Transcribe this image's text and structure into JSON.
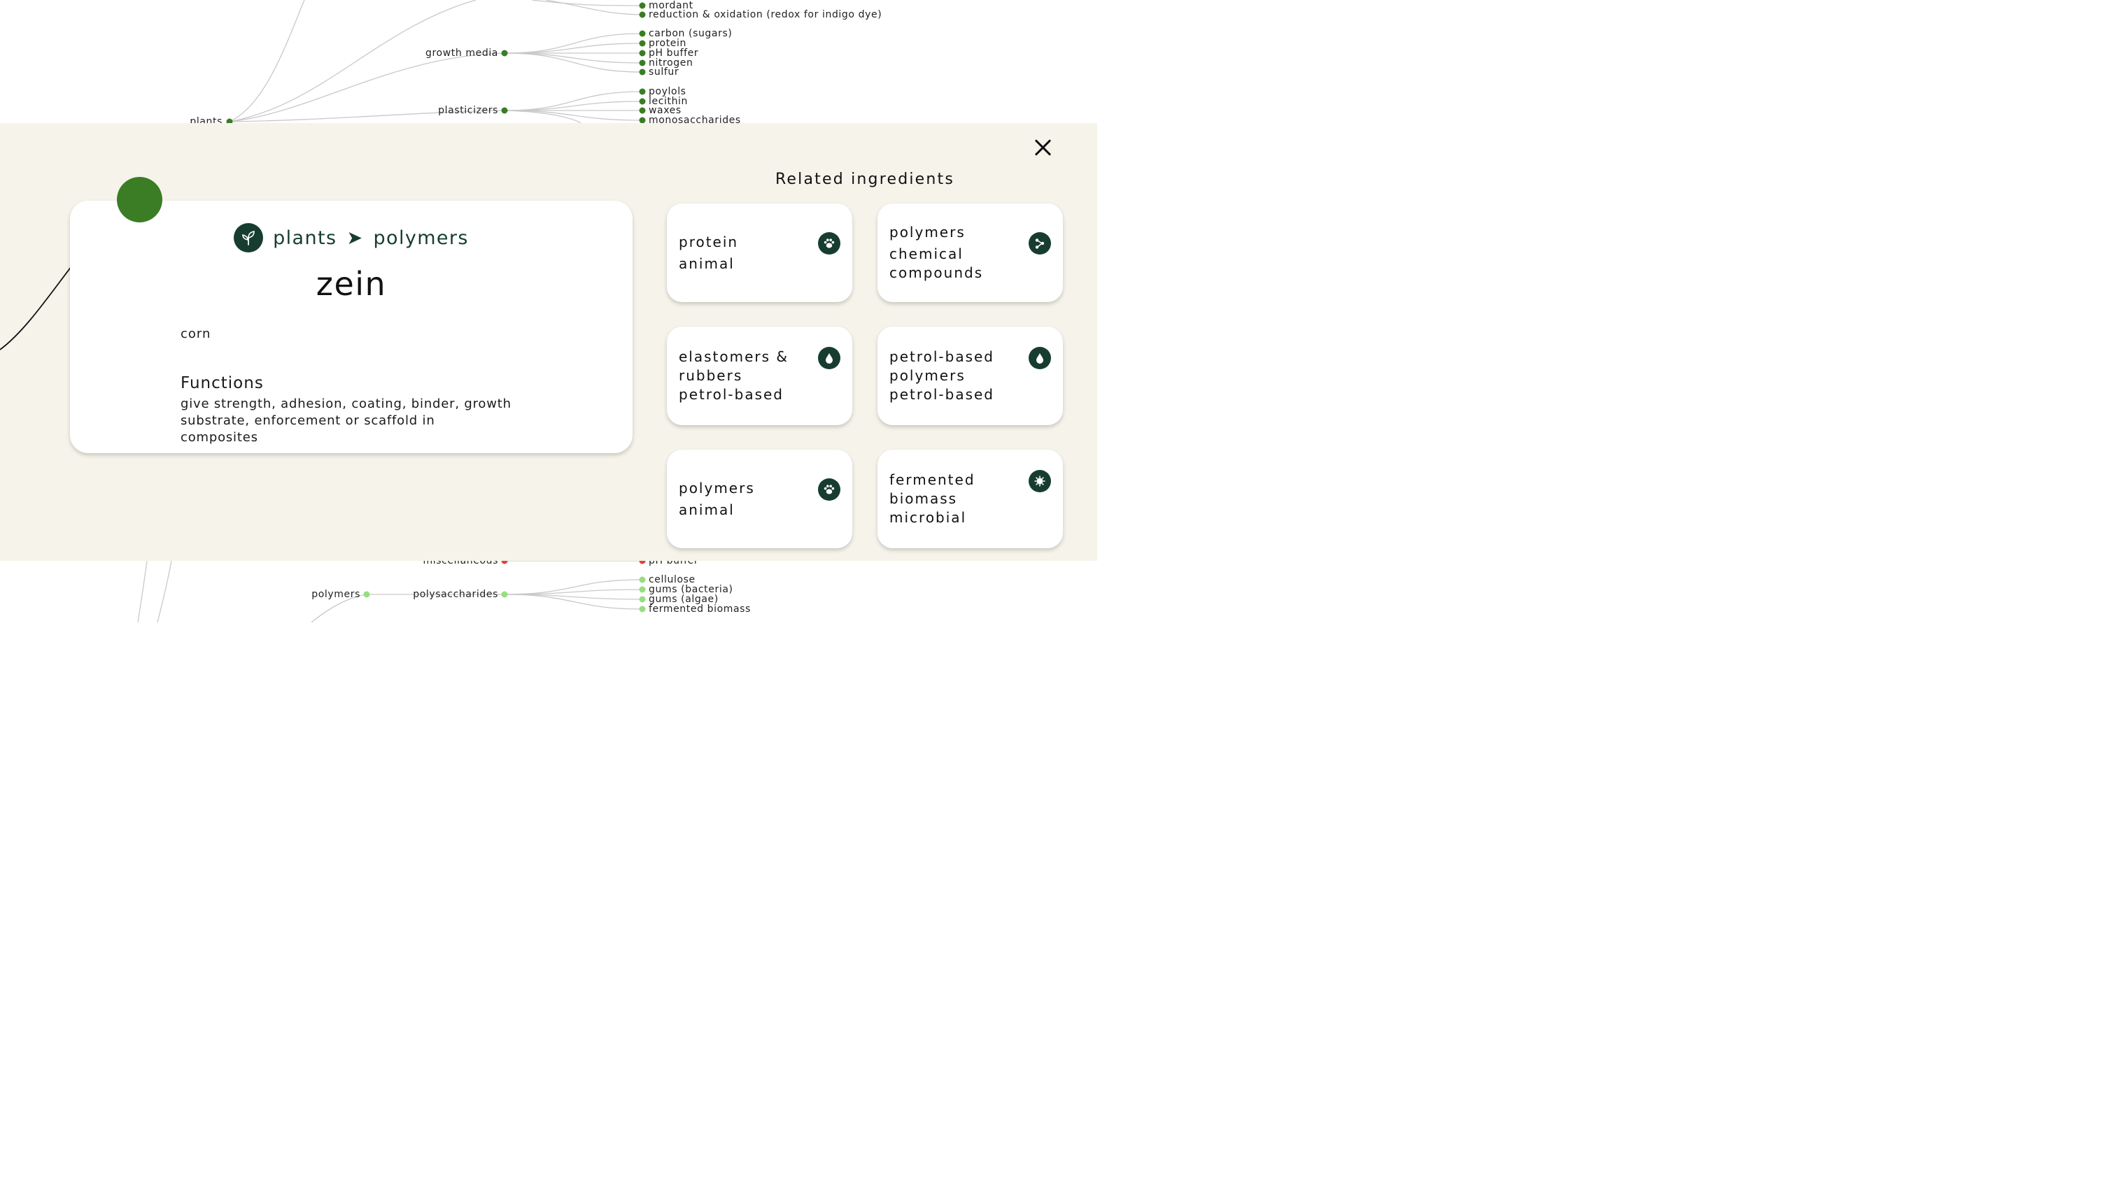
{
  "tree": {
    "labels": {
      "plants": "plants",
      "growth_media": "growth media",
      "plasticizers": "plasticizers",
      "miscellaneous": "miscellaneous",
      "polymers": "polymers",
      "polysaccharides": "polysaccharides"
    },
    "leaves": {
      "mordant": "mordant",
      "redox": "reduction & oxidation (redox for indigo dye)",
      "carbon": "carbon (sugars)",
      "protein": "protein",
      "ph_buffer": "pH buffer",
      "nitrogen": "nitrogen",
      "sulfur": "sulfur",
      "poylols": "poylols",
      "lecithin": "lecithin",
      "waxes": "waxes",
      "monosaccharides": "monosaccharides",
      "ph_buffer_2": "pH buffer",
      "cellulose": "cellulose",
      "gums_bacteria": "gums (bacteria)",
      "gums_algae": "gums (algae)",
      "fermented_biomass": "fermented biomass"
    },
    "colors": {
      "plants": "#3a7d24",
      "miscellaneous": "#e0433a",
      "polymers": "#97dd83",
      "link": "#c9c9c9"
    }
  },
  "detail": {
    "breadcrumb": {
      "category": "plants",
      "separator": "➤",
      "subcategory": "polymers"
    },
    "crumb_icon": "sprout-icon",
    "title": "zein",
    "source": "corn",
    "functions_heading": "Functions",
    "functions_text": "give strength, adhesion, coating, binder, growth substrate, enforcement or scaffold in composites",
    "accent": "#3a7d24",
    "close_icon": "close-icon"
  },
  "related": {
    "heading": "Related ingredients",
    "items": [
      {
        "name": "protein",
        "category": "animal",
        "icon": "paw-icon"
      },
      {
        "name": "polymers",
        "category": "chemical compounds",
        "icon": "molecule-icon"
      },
      {
        "name": "elastomers & rubbers",
        "category": "petrol-based",
        "icon": "drop-icon"
      },
      {
        "name": "petrol-based polymers",
        "category": "petrol-based",
        "icon": "drop-icon"
      },
      {
        "name": "polymers",
        "category": "animal",
        "icon": "paw-icon"
      },
      {
        "name": "fermented biomass",
        "category": "microbial",
        "icon": "microbe-icon"
      }
    ],
    "icon_bg": "#173d30"
  }
}
